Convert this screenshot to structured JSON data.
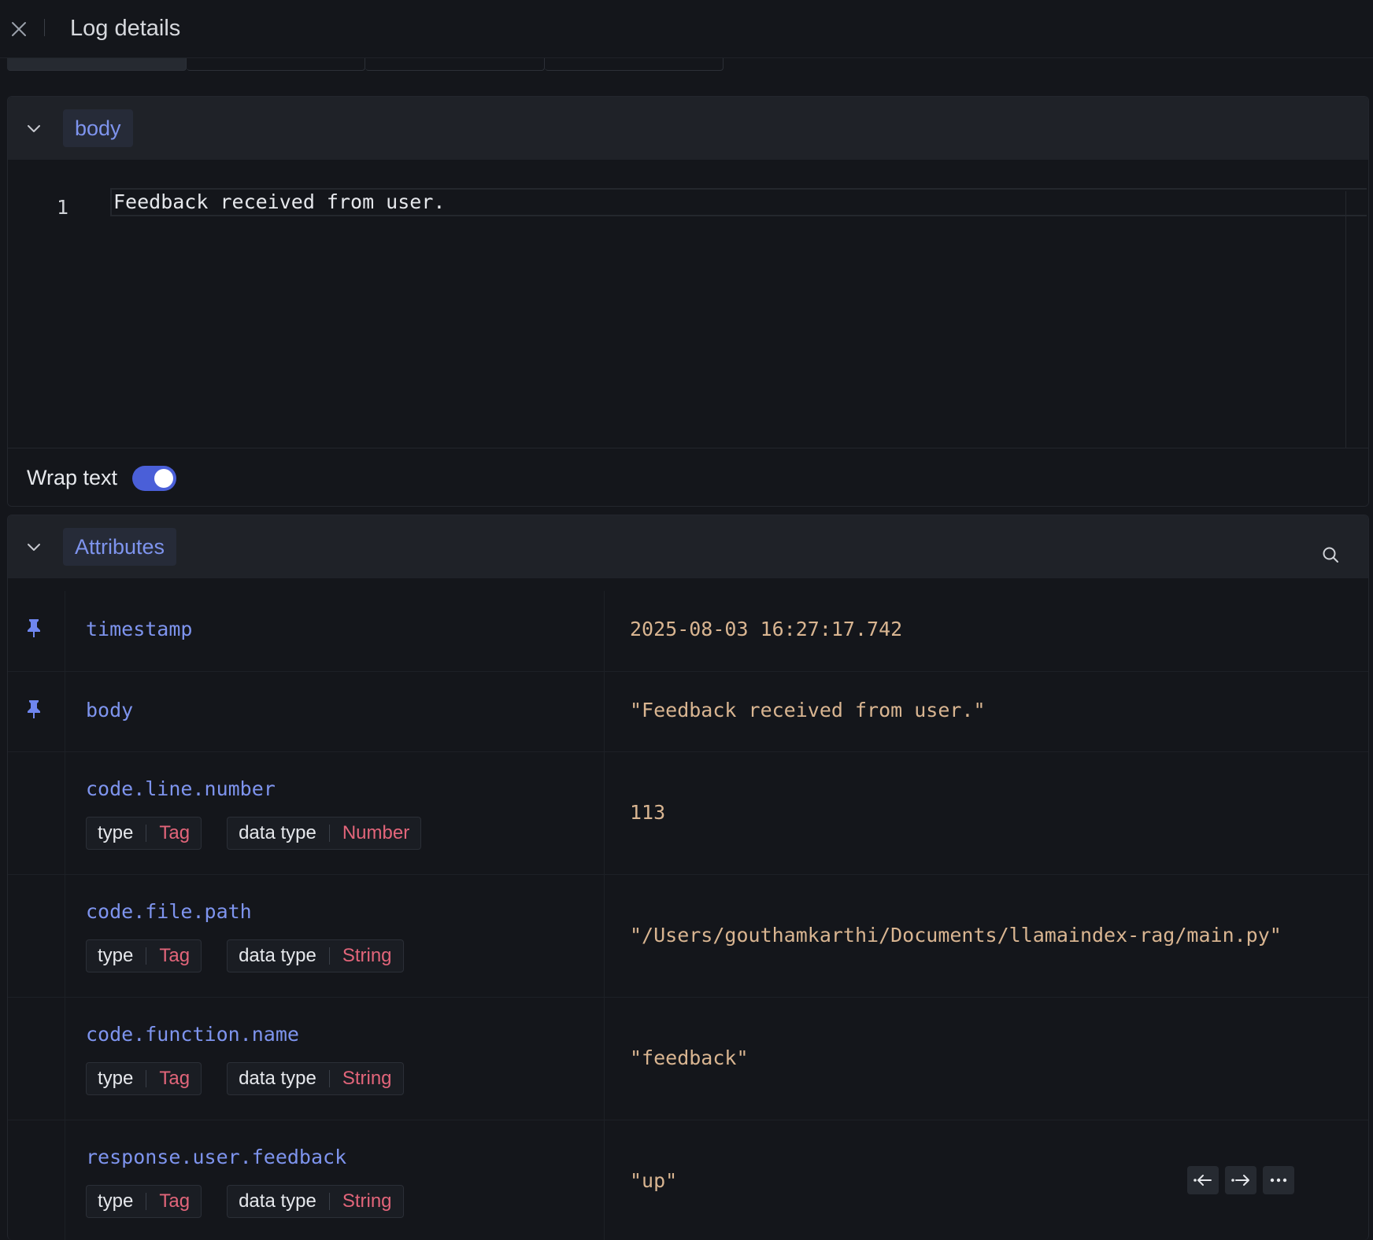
{
  "header": {
    "title": "Log details"
  },
  "body_section": {
    "label": "body",
    "line_number": "1",
    "line_text": "Feedback received from user.",
    "wrap_label": "Wrap text",
    "wrap_enabled": true
  },
  "attributes_section": {
    "label": "Attributes",
    "rows": [
      {
        "key": "timestamp",
        "value": "2025-08-03 16:27:17.742",
        "pinned": true
      },
      {
        "key": "body",
        "value": "\"Feedback received from user.\"",
        "pinned": true
      },
      {
        "key": "code.line.number",
        "type_label": "type",
        "type_value": "Tag",
        "dtype_label": "data type",
        "dtype_value": "Number",
        "value": "113"
      },
      {
        "key": "code.file.path",
        "type_label": "type",
        "type_value": "Tag",
        "dtype_label": "data type",
        "dtype_value": "String",
        "value": "\"/Users/gouthamkarthi/Documents/llamaindex-rag/main.py\""
      },
      {
        "key": "code.function.name",
        "type_label": "type",
        "type_value": "Tag",
        "dtype_label": "data type",
        "dtype_value": "String",
        "value": "\"feedback\""
      },
      {
        "key": "response.user.feedback",
        "type_label": "type",
        "type_value": "Tag",
        "dtype_label": "data type",
        "dtype_value": "String",
        "value": "\"up\""
      }
    ]
  },
  "colors": {
    "accent": "#7e94ee",
    "tag_value": "#e2657a",
    "attr_value": "#d9b591",
    "toggle_on": "#4a5fd8"
  }
}
